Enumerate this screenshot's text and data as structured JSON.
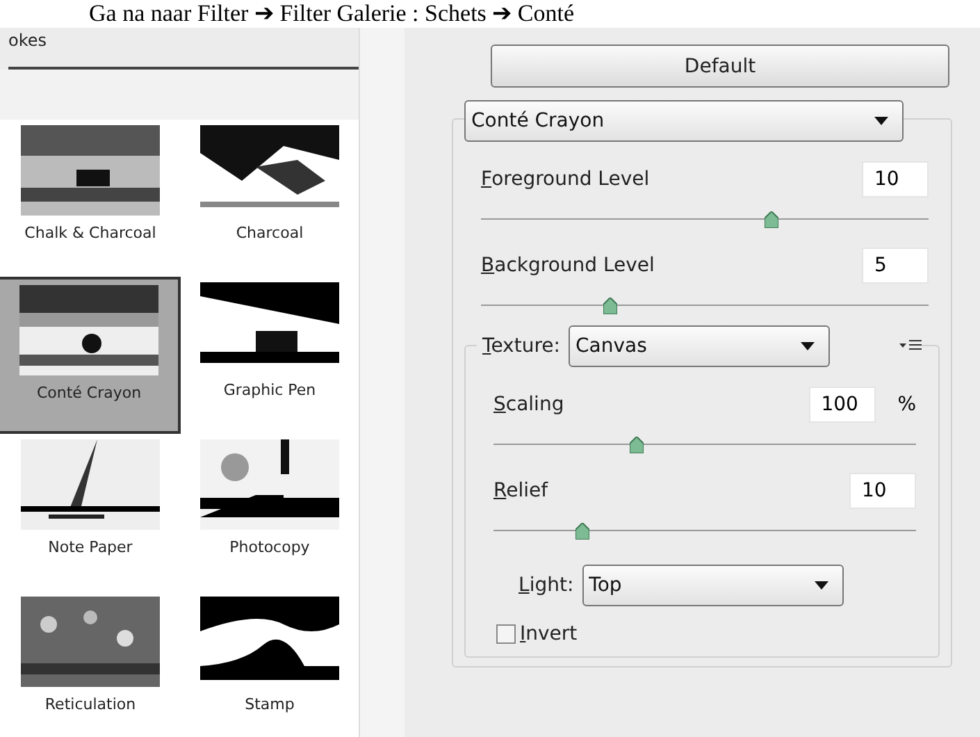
{
  "caption": "Ga na naar Filter ➔ Filter Galerie : Schets ➔ Conté",
  "gallery": {
    "folder": "okes",
    "thumbnails": [
      {
        "label": "Chalk & Charcoal",
        "selected": false
      },
      {
        "label": "Charcoal",
        "selected": false
      },
      {
        "label": "Conté Crayon",
        "selected": true
      },
      {
        "label": "Graphic Pen",
        "selected": false
      },
      {
        "label": "Note Paper",
        "selected": false
      },
      {
        "label": "Photocopy",
        "selected": false
      },
      {
        "label": "Reticulation",
        "selected": false
      },
      {
        "label": "Stamp",
        "selected": false
      }
    ]
  },
  "settings": {
    "default_button": "Default",
    "filter": "Conté Crayon",
    "sliders": [
      {
        "label": "Foreground Level",
        "value": "10",
        "level": 0.65
      },
      {
        "label": "Background Level",
        "value": "5",
        "level": 0.29
      }
    ],
    "texture": {
      "label": "Texture:",
      "value": "Canvas",
      "sliders": [
        {
          "label": "Scaling",
          "value": "100",
          "unit": "%",
          "level": 0.34
        },
        {
          "label": "Relief",
          "value": "10",
          "level": 0.21
        }
      ],
      "light": {
        "label": "Light:",
        "value": "Top"
      },
      "invert": {
        "label": "Invert",
        "checked": false
      }
    }
  }
}
